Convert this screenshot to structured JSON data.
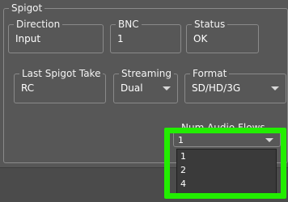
{
  "spigot": {
    "title": "Spigot",
    "direction": {
      "label": "Direction",
      "value": "Input"
    },
    "bnc": {
      "label": "BNC",
      "value": "1"
    },
    "status": {
      "label": "Status",
      "value": "OK"
    },
    "last_take": {
      "label": "Last Spigot Take",
      "value": "RC"
    },
    "streaming": {
      "label": "Streaming",
      "value": "Dual"
    },
    "format": {
      "label": "Format",
      "value": "SD/HD/3G"
    },
    "num_audio_flows": {
      "label": "Num Audio Flows",
      "value": "1",
      "options": [
        "1",
        "2",
        "4"
      ]
    }
  },
  "colors": {
    "background": "#575757",
    "highlight": "#22ee00",
    "list_background": "#3a3a3a"
  }
}
